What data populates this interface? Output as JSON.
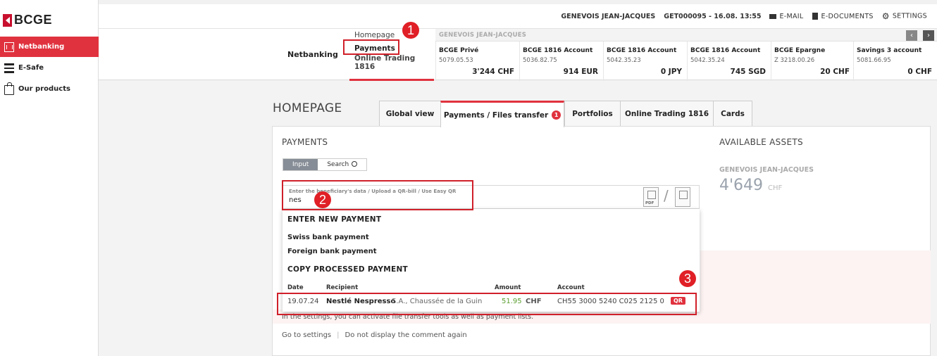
{
  "brand": {
    "name": "BCGE"
  },
  "sidebar": {
    "items": [
      {
        "label": "Netbanking",
        "icon": "bank-icon"
      },
      {
        "label": "E-Safe",
        "icon": "esafe-icon"
      },
      {
        "label": "Our products",
        "icon": "shopping-bag-icon"
      }
    ]
  },
  "topbar": {
    "user": "GENEVOIS JEAN-JACQUES",
    "session": "GET000095 - 16.08. 13:55",
    "email": "E-MAIL",
    "edocuments": "E-DOCUMENTS",
    "settings": "SETTINGS"
  },
  "accountbar": {
    "section_label": "Netbanking",
    "menu": [
      "Homepage",
      "Payments",
      "Online Trading 1816"
    ],
    "owner": "GENEVOIS JEAN-JACQUES",
    "nav_prev": "‹",
    "nav_next": "›",
    "accounts": [
      {
        "name": "BCGE Privé",
        "number": "5079.05.53",
        "balance": "3'244 CHF"
      },
      {
        "name": "BCGE 1816 Account",
        "number": "5036.82.75",
        "balance": "914 EUR"
      },
      {
        "name": "BCGE 1816 Account",
        "number": "5042.35.23",
        "balance": "0 JPY"
      },
      {
        "name": "BCGE 1816 Account",
        "number": "5042.35.24",
        "balance": "745 SGD"
      },
      {
        "name": "BCGE Epargne",
        "number": "Z 3218.00.26",
        "balance": "20 CHF"
      },
      {
        "name": "Savings 3 account",
        "number": "5081.66.95",
        "balance": "0 CHF"
      }
    ]
  },
  "homepage": {
    "title": "HOMEPAGE",
    "tabs": [
      "Global view",
      "Payments / Files transfer",
      "Portfolios",
      "Online Trading 1816",
      "Cards"
    ],
    "active_tab_badge": "1"
  },
  "payments": {
    "title": "PAYMENTS",
    "mode_input": "Input",
    "mode_search": "Search",
    "field_placeholder": "Enter the beneficiary's data / Upload a QR-bill / Use Easy QR",
    "field_value": "nes",
    "pdf_label": "PDF"
  },
  "dropdown": {
    "new_payment_header": "ENTER NEW PAYMENT",
    "swiss": "Swiss bank payment",
    "foreign": "Foreign bank payment",
    "copy_header": "COPY PROCESSED PAYMENT",
    "columns": {
      "date": "Date",
      "recipient": "Recipient",
      "amount": "Amount",
      "account": "Account"
    },
    "row": {
      "date": "19.07.24",
      "recipient_bold": "Nestlé Nespresso",
      "recipient_rest": "S.A., Chaussée de la Guing",
      "amount": "51.95",
      "currency": "CHF",
      "account": "CH55 3000 5240 C025 2125 0",
      "tag": "QR"
    }
  },
  "assets": {
    "title": "AVAILABLE ASSETS",
    "owner": "GENEVOIS JEAN-JACQUES",
    "amount": "4'649",
    "currency": "CHF"
  },
  "notice": {
    "text": "In the settings, you can activate file transfer tools as well as payment lists.",
    "go_settings": "Go to settings",
    "dismiss": "Do not display the comment again"
  },
  "annotations": {
    "one": "1",
    "two": "2",
    "three": "3"
  },
  "colors": {
    "accent": "#e0323e",
    "annotation": "#d0202a",
    "amount_green": "#5a9e2f"
  }
}
